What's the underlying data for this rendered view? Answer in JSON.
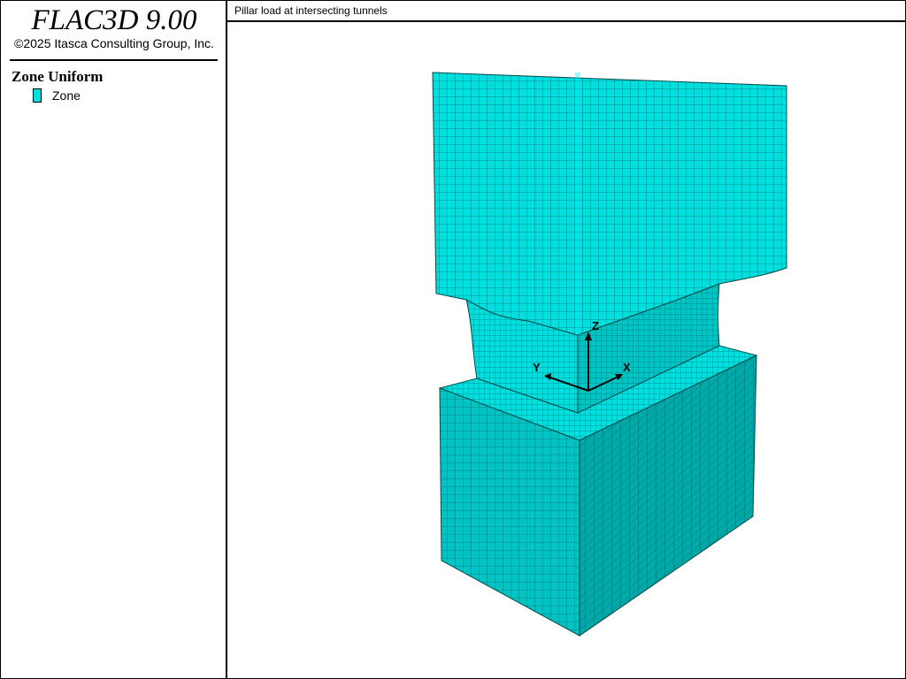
{
  "app": {
    "title": "FLAC3D 9.00",
    "copyright": "©2025 Itasca Consulting Group, Inc."
  },
  "legend": {
    "heading": "Zone Uniform",
    "items": [
      {
        "label": "Zone",
        "color": "#00e0e0"
      }
    ]
  },
  "view": {
    "title": "Pillar load at intersecting tunnels"
  },
  "axes": {
    "x_label": "X",
    "y_label": "Y",
    "z_label": "Z"
  },
  "colors": {
    "zone_face_light": "#00dede",
    "zone_face_mid": "#00c4c4",
    "zone_face_dark": "#00a8a8",
    "mesh_line": "#004848"
  }
}
